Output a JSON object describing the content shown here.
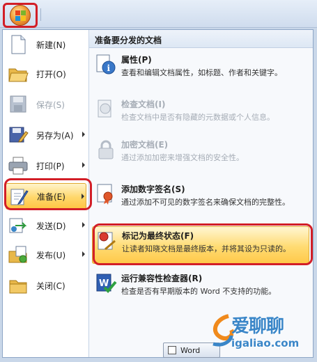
{
  "left_menu": [
    {
      "label": "新建(N)",
      "icon": "new-document-icon",
      "disabled": false,
      "submenu": false
    },
    {
      "label": "打开(O)",
      "icon": "open-folder-icon",
      "disabled": false,
      "submenu": false
    },
    {
      "label": "保存(S)",
      "icon": "save-disk-icon",
      "disabled": true,
      "submenu": false
    },
    {
      "label": "另存为(A)",
      "icon": "save-as-icon",
      "disabled": false,
      "submenu": true
    },
    {
      "label": "打印(P)",
      "icon": "printer-icon",
      "disabled": false,
      "submenu": true
    },
    {
      "label": "准备(E)",
      "icon": "prepare-icon",
      "disabled": false,
      "submenu": true,
      "selected": true
    },
    {
      "label": "发送(D)",
      "icon": "send-icon",
      "disabled": false,
      "submenu": true
    },
    {
      "label": "发布(U)",
      "icon": "publish-icon",
      "disabled": false,
      "submenu": true
    },
    {
      "label": "关闭(C)",
      "icon": "close-folder-icon",
      "disabled": false,
      "submenu": false
    }
  ],
  "right_pane": {
    "header": "准备要分发的文档",
    "items": [
      {
        "title": "属性(P)",
        "desc": "查看和编辑文档属性，如标题、作者和关键字。",
        "icon": "properties-icon",
        "disabled": false
      },
      {
        "title": "检查文档(I)",
        "desc": "检查文档中是否有隐藏的元数据或个人信息。",
        "icon": "inspect-document-icon",
        "disabled": true
      },
      {
        "title": "加密文档(E)",
        "desc": "通过添加加密来增强文档的安全性。",
        "icon": "encrypt-lock-icon",
        "disabled": true
      },
      {
        "title": "添加数字签名(S)",
        "desc": "通过添加不可见的数字签名来确保文档的完整性。",
        "icon": "digital-signature-icon",
        "disabled": false
      },
      {
        "title": "标记为最终状态(F)",
        "desc": "让读者知晓文档是最终版本，并将其设为只读的。",
        "icon": "mark-final-icon",
        "disabled": false,
        "selected": true
      },
      {
        "title": "运行兼容性检查器(R)",
        "desc": "检查是否有早期版本的 Word 不支持的功能。",
        "icon": "compatibility-checker-icon",
        "disabled": false
      }
    ]
  },
  "taskbar": {
    "label": "Word"
  },
  "watermark": {
    "cn": "爱聊聊",
    "url": "igaliao.com"
  },
  "colors": {
    "highlight": "#ffd76a",
    "annotation_red": "#d21e27",
    "accent_blue": "#3a86c8"
  }
}
